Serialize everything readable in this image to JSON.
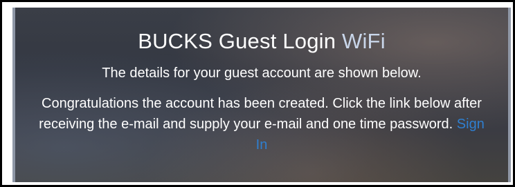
{
  "header": {
    "title_main": "BUCKS Guest Login",
    "title_accent": "WiFi"
  },
  "content": {
    "subtitle": "The details for your guest account are shown below.",
    "message": "Congratulations the account has been created. Click the link below after receiving the e-mail and supply your e-mail and one time password.",
    "signin_link": "Sign In"
  },
  "colors": {
    "link": "#2f7fd0",
    "panel_background": "#363a44",
    "text": "#ffffff"
  }
}
